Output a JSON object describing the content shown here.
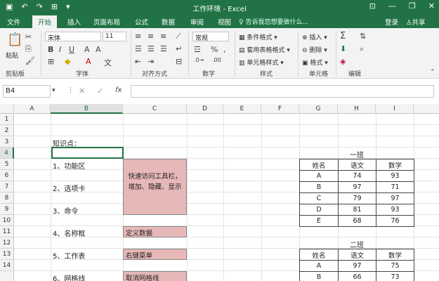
{
  "titlebar": {
    "title": "工作环境 - Excel",
    "save_icon": "save-icon",
    "undo_icon": "undo-icon",
    "redo_icon": "redo-icon",
    "min_glyph": "—",
    "restore_glyph": "❐",
    "close_glyph": "✕",
    "options_glyph": "⊡"
  },
  "tabs": {
    "file": "文件",
    "home": "开始",
    "insert": "插入",
    "layout": "页面布局",
    "formulas": "公式",
    "data": "数据",
    "review": "审阅",
    "view": "视图",
    "tellme": "告诉我您想要做什么...",
    "login": "登录",
    "share": "共享"
  },
  "ribbon": {
    "paste": "粘贴",
    "clipboard": "剪贴板",
    "font_name": "宋体",
    "font_size": "11",
    "font": "字体",
    "alignment": "对齐方式",
    "number_format": "常规",
    "number": "数字",
    "cond_format": "条件格式",
    "table_format": "套用表格格式",
    "cell_styles": "单元格样式",
    "styles": "样式",
    "insert": "插入",
    "delete": "删除",
    "format": "格式",
    "cells": "单元格",
    "editing": "编辑",
    "percent": "%",
    "comma": ","
  },
  "formula_bar": {
    "name_box": "B4",
    "fx": "fx",
    "value": ""
  },
  "sheet": {
    "columns": [
      "A",
      "B",
      "C",
      "D",
      "E",
      "F",
      "G",
      "H",
      "I"
    ],
    "rows": [
      "1",
      "2",
      "3",
      "4",
      "5",
      "6",
      "7",
      "8",
      "9",
      "10",
      "11",
      "12",
      "13",
      "14"
    ],
    "b3": "知识点：",
    "b5": "1、功能区",
    "b7": "2、选项卡",
    "b9": "3、命令",
    "b11": "4、名称框",
    "b13": "5、工作表",
    "b14": "6、网格线",
    "c_qat": "快速访问工具栏，增加、隐藏、显示",
    "c11": "定义数据",
    "c13": "右键菜单",
    "c14": "取消网格线"
  },
  "class1": {
    "title": "一班",
    "header": [
      "姓名",
      "语文",
      "数学"
    ],
    "rows": [
      [
        "A",
        "74",
        "93"
      ],
      [
        "B",
        "97",
        "71"
      ],
      [
        "C",
        "79",
        "97"
      ],
      [
        "D",
        "81",
        "93"
      ],
      [
        "E",
        "68",
        "76"
      ]
    ]
  },
  "class2": {
    "title": "二班",
    "header": [
      "姓名",
      "语文",
      "数学"
    ],
    "rows": [
      [
        "A",
        "97",
        "75"
      ],
      [
        "B",
        "66",
        "73"
      ]
    ]
  },
  "colors": {
    "brand": "#217346",
    "pink_fill": "#e6b8b7"
  }
}
